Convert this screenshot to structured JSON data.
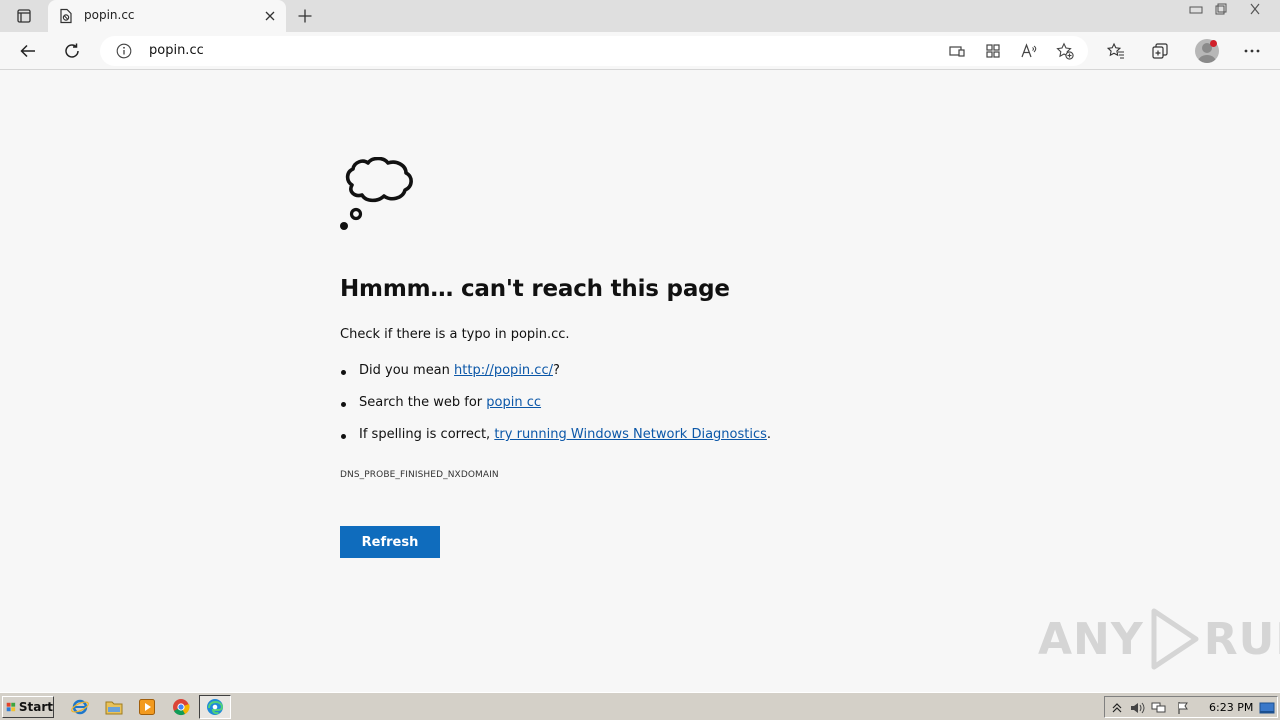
{
  "browser": {
    "tab_title": "popin.cc",
    "address_url": "popin.cc"
  },
  "page": {
    "heading": "Hmmm… can't reach this page",
    "subtext": "Check if there is a typo in popin.cc.",
    "suggestions": [
      {
        "prefix": "Did you mean ",
        "link": "http://popin.cc/",
        "suffix": "?"
      },
      {
        "prefix": "Search the web for ",
        "link": "popin cc",
        "suffix": ""
      },
      {
        "prefix": "If spelling is correct, ",
        "link": "try running Windows Network Diagnostics",
        "suffix": "."
      }
    ],
    "error_code": "DNS_PROBE_FINISHED_NXDOMAIN",
    "refresh_label": "Refresh"
  },
  "watermark": {
    "left": "ANY",
    "right": "RUN"
  },
  "taskbar": {
    "start_label": "Start",
    "clock": "6:23 PM"
  },
  "colors": {
    "accent": "#0f6cbd",
    "link": "#0b57a8"
  },
  "icons": {
    "tab_actions": "tab-actions-icon",
    "favicon": "page-error-icon",
    "tab_close": "close-icon",
    "new_tab": "plus-icon",
    "back": "back-arrow-icon",
    "refresh": "refresh-icon",
    "site_info": "info-icon",
    "cloud": "thought-cloud-icon"
  }
}
